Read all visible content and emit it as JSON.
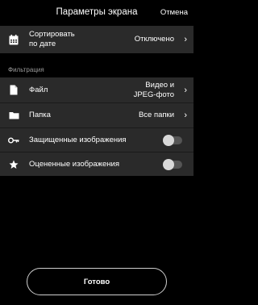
{
  "header": {
    "title": "Параметры экрана",
    "cancel": "Отмена"
  },
  "sort": {
    "label_line1": "Сортировать",
    "label_line2": "по дате",
    "value": "Отключено",
    "icon": "calendar-icon"
  },
  "filter": {
    "section_title": "Фильтрация",
    "file": {
      "label": "Файл",
      "value_line1": "Видео и",
      "value_line2": "JPEG-фото",
      "icon": "file-icon"
    },
    "folder": {
      "label": "Папка",
      "value": "Все папки",
      "icon": "folder-icon"
    },
    "protected": {
      "label": "Защищенные изображения",
      "enabled": false,
      "icon": "key-icon"
    },
    "rated": {
      "label": "Оцененные изображения",
      "enabled": false,
      "icon": "star-icon"
    }
  },
  "done_label": "Готово"
}
